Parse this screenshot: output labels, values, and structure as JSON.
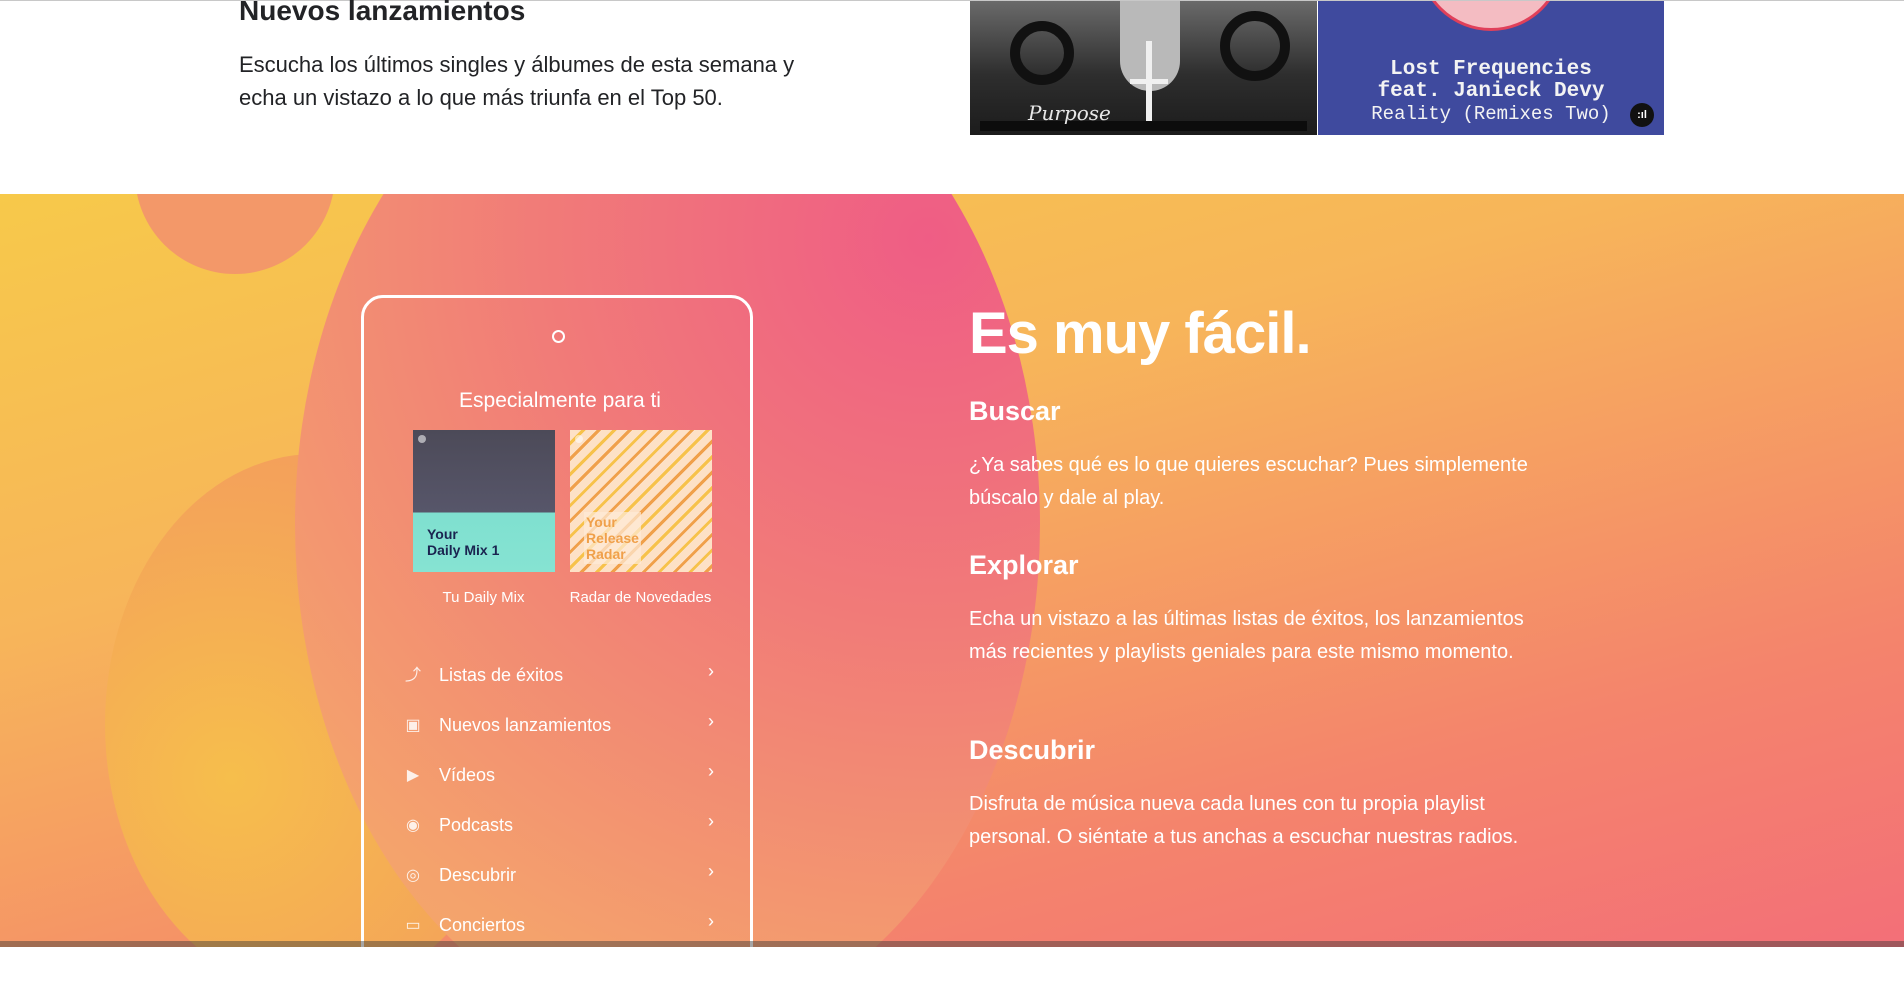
{
  "releases": {
    "title": "Nuevos lanzamientos",
    "description": "Escucha los últimos singles y álbumes de esta semana y echa un vistazo a lo que más triunfa en el Top 50.",
    "cover_left": {
      "script_text": "Purpose"
    },
    "cover_right": {
      "line1": "Lost Frequencies",
      "line2": "feat. Janieck Devy",
      "line3": "Reality (Remixes Two)"
    }
  },
  "phone": {
    "heading": "Especialmente para ti",
    "cards": [
      {
        "art_text_1": "Your",
        "art_text_2": "Daily Mix 1",
        "caption": "Tu Daily Mix"
      },
      {
        "art_text_1": "Your",
        "art_text_2": "Release",
        "art_text_3": "Radar",
        "caption": "Radar de Novedades"
      }
    ],
    "menu": [
      {
        "label": "Listas de éxitos",
        "icon": "trending-icon"
      },
      {
        "label": "Nuevos lanzamientos",
        "icon": "calendar-icon"
      },
      {
        "label": "Vídeos",
        "icon": "video-icon"
      },
      {
        "label": "Podcasts",
        "icon": "podcast-icon"
      },
      {
        "label": "Descubrir",
        "icon": "discover-icon"
      },
      {
        "label": "Conciertos",
        "icon": "ticket-icon"
      }
    ]
  },
  "hero": {
    "title": "Es muy fácil.",
    "features": [
      {
        "heading": "Buscar",
        "text": "¿Ya sabes qué es lo que quieres escuchar? Pues simplemente búscalo y dale al play."
      },
      {
        "heading": "Explorar",
        "text": "Echa un vistazo a las últimas listas de éxitos, los lanzamientos más recientes y playlists geniales para este mismo momento."
      },
      {
        "heading": "Descubrir",
        "text": "Disfruta de música nueva cada lunes con tu propia playlist personal. O siéntate a tus anchas a escuchar nuestras radios."
      }
    ]
  },
  "colors": {
    "gradient_yellow": "#f7c94a",
    "gradient_pink": "#ef5d85",
    "gradient_coral": "#f36f78",
    "text_dark": "#222326",
    "cover_blue": "#3f4a9e"
  }
}
